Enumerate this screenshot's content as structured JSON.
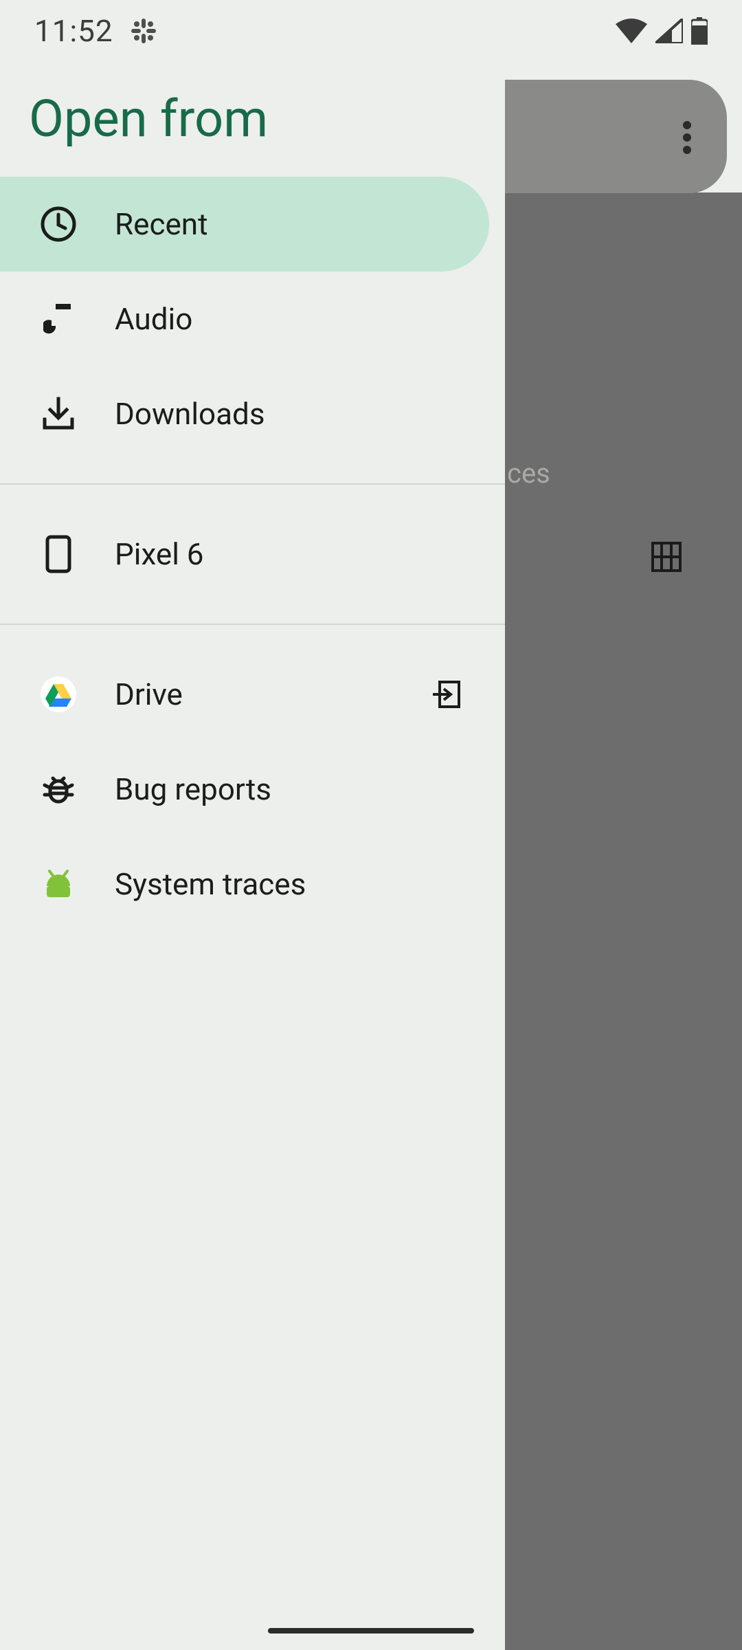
{
  "status": {
    "time": "11:52"
  },
  "drawer": {
    "title": "Open from",
    "items": [
      {
        "label": "Recent"
      },
      {
        "label": "Audio"
      },
      {
        "label": "Downloads"
      },
      {
        "label": "Pixel 6"
      },
      {
        "label": "Drive"
      },
      {
        "label": "Bug reports"
      },
      {
        "label": "System traces"
      }
    ]
  },
  "background": {
    "partial_text": "ces"
  }
}
